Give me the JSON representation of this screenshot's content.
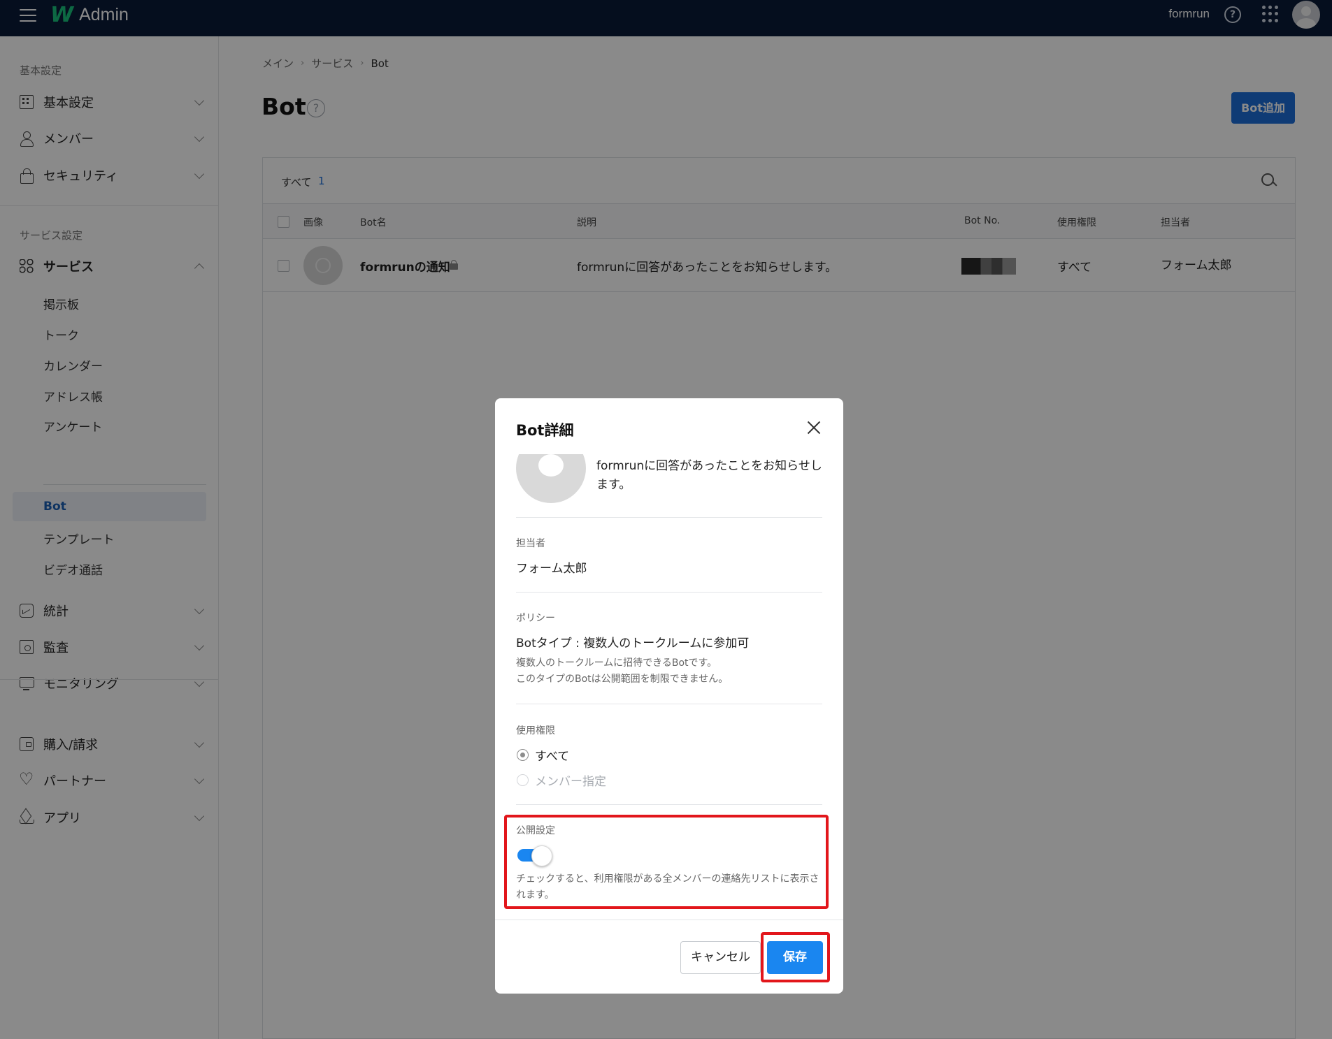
{
  "topbar": {
    "app_name": "Admin",
    "logo_letter": "W",
    "user_name": "formrun",
    "help_symbol": "?",
    "icons": [
      "menu-icon",
      "help-icon",
      "app-grid-icon",
      "avatar"
    ]
  },
  "sidebar": {
    "section_basic": "基本設定",
    "basic_items": [
      {
        "label": "基本設定",
        "icon": "building-icon"
      },
      {
        "label": "メンバー",
        "icon": "user-icon"
      },
      {
        "label": "セキュリティ",
        "icon": "lock-icon"
      }
    ],
    "section_service": "サービス設定",
    "service_group": {
      "label": "サービス",
      "icon": "apps-icon"
    },
    "service_subitems": [
      "掲示板",
      "トーク",
      "カレンダー",
      "アドレス帳",
      "アンケート"
    ],
    "active_item": "Bot",
    "service_subitems_after": [
      "テンプレート",
      "ビデオ通話"
    ],
    "other_items": [
      {
        "label": "統計",
        "icon": "chart-icon"
      },
      {
        "label": "監査",
        "icon": "audit-icon"
      },
      {
        "label": "モニタリング",
        "icon": "monitor-icon"
      }
    ],
    "bottom_items": [
      {
        "label": "購入/請求",
        "icon": "wallet-icon"
      },
      {
        "label": "パートナー",
        "icon": "heart-icon"
      },
      {
        "label": "アプリ",
        "icon": "layers-icon"
      }
    ]
  },
  "breadcrumb": [
    "メイン",
    "サービス",
    "Bot"
  ],
  "page": {
    "title": "Bot",
    "help_symbol": "?",
    "add_button": "Bot追加"
  },
  "filter": {
    "label": "すべて",
    "count": "1"
  },
  "table": {
    "columns": [
      "画像",
      "Bot名",
      "説明",
      "Bot No.",
      "使用権限",
      "担当者"
    ],
    "rows": [
      {
        "name": "formrunの通知",
        "description": "formrunに回答があったことをお知らせします。",
        "permission": "すべて",
        "owner": "フォーム太郎"
      }
    ]
  },
  "modal": {
    "title": "Bot詳細",
    "description_line1": "formrunに回答があったことをお知らせし",
    "description_line2": "ます。",
    "owner_label": "担当者",
    "owner_value": "フォーム太郎",
    "policy_label": "ポリシー",
    "policy_value": "Botタイプ : 複数人のトークルームに参加可",
    "policy_help_line1": "複数人のトークルームに招待できるBotです。",
    "policy_help_line2": "このタイプのBotは公開範囲を制限できません。",
    "permission_label": "使用権限",
    "permission_options": [
      {
        "label": "すべて",
        "selected": true,
        "disabled": false
      },
      {
        "label": "メンバー指定",
        "selected": false,
        "disabled": true
      }
    ],
    "public_label": "公開設定",
    "public_enabled": true,
    "public_help_line1": "チェックすると、利用権限がある全メンバーの連絡先リストに表示さ",
    "public_help_line2": "れます。",
    "cancel_button": "キャンセル",
    "save_button": "保存"
  },
  "colors": {
    "topbar": "#0b1b38",
    "accent": "#1d6ed8",
    "toggle_on": "#1a86f0",
    "highlight": "#e2161b",
    "logo": "#19c37d"
  }
}
